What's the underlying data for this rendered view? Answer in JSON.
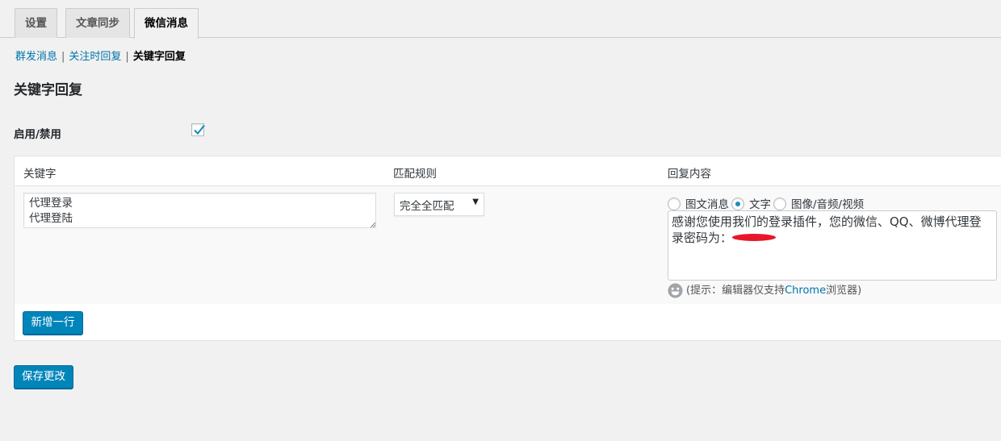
{
  "tabs": [
    {
      "label": "设置"
    },
    {
      "label": "文章同步"
    },
    {
      "label": "微信消息"
    }
  ],
  "subnav": {
    "items": [
      "群发消息",
      "关注时回复",
      "关键字回复"
    ],
    "separator": "|"
  },
  "page_title": "关键字回复",
  "enable": {
    "label": "启用/禁用",
    "checked": true
  },
  "table": {
    "headers": [
      "关键字",
      "匹配规则",
      "回复内容"
    ],
    "row": {
      "keywords": "代理登录\n代理登陆",
      "match_rule": "完全全匹配",
      "reply_types": [
        "图文消息",
        "文字",
        "图像/音频/视频"
      ],
      "selected_type": "文字",
      "reply_text": "感谢您使用我们的登录插件，您的微信、QQ、微博代理登录密码为："
    }
  },
  "hint": {
    "prefix": "(提示：编辑器仅支持",
    "highlight": "Chrome",
    "suffix": "浏览器)"
  },
  "buttons": {
    "add_row": "新增一行",
    "save": "保存更改"
  },
  "colors": {
    "primary": "#0085ba",
    "link": "#0073aa",
    "redaction": "#e8162a"
  },
  "icons": {
    "checkmark": "checkmark-icon",
    "emoji": "emoji-smile-icon",
    "dropdown": "chevron-down-icon"
  }
}
